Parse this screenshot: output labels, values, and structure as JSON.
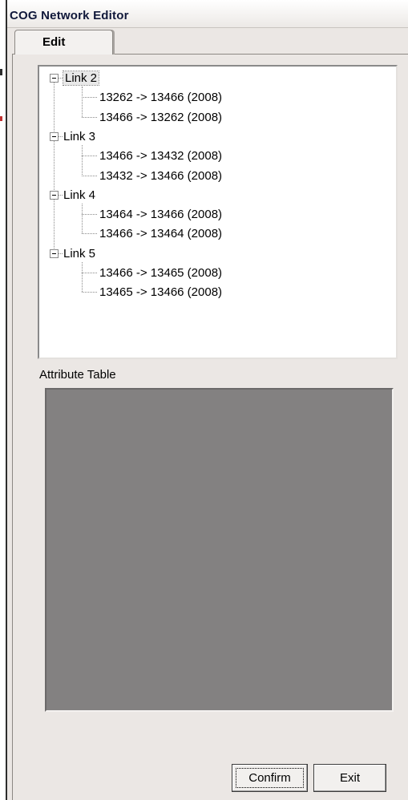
{
  "window": {
    "title": "COG Network Editor"
  },
  "tabs": [
    {
      "label": "Edit",
      "active": true
    }
  ],
  "tree": {
    "nodes": [
      {
        "label": "Link 2",
        "expanded": true,
        "selected": true,
        "children": [
          "13262 -> 13466 (2008)",
          "13466 -> 13262 (2008)"
        ]
      },
      {
        "label": "Link 3",
        "expanded": true,
        "selected": false,
        "children": [
          "13466 -> 13432 (2008)",
          "13432 -> 13466 (2008)"
        ]
      },
      {
        "label": "Link 4",
        "expanded": true,
        "selected": false,
        "children": [
          "13464 -> 13466 (2008)",
          "13466 -> 13464 (2008)"
        ]
      },
      {
        "label": "Link 5",
        "expanded": true,
        "selected": false,
        "children": [
          "13466 -> 13465 (2008)",
          "13465 -> 13466 (2008)"
        ]
      }
    ]
  },
  "attribute_table": {
    "label": "Attribute Table"
  },
  "buttons": {
    "confirm": "Confirm",
    "exit": "Exit"
  }
}
